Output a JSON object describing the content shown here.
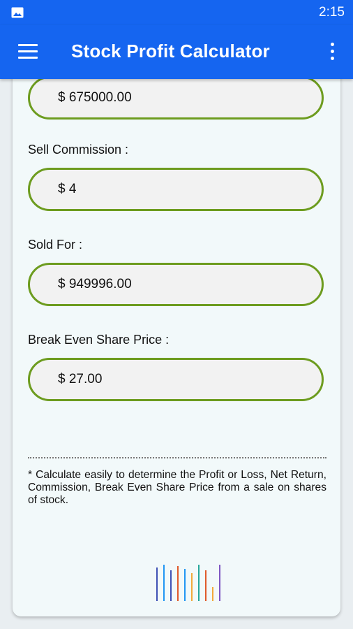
{
  "status_bar": {
    "time": "2:15",
    "left_icon": "image-notification-icon"
  },
  "app_bar": {
    "title": "Stock Profit Calculator",
    "menu_icon": "hamburger-menu-icon",
    "more_icon": "more-vert-icon"
  },
  "fields": {
    "total_cost": {
      "value": "$ 675000.00"
    },
    "sell_commission": {
      "label": "Sell Commission :",
      "value": "$ 4"
    },
    "sold_for": {
      "label": "Sold For :",
      "value": "$ 949996.00"
    },
    "break_even": {
      "label": "Break Even Share Price :",
      "value": "$ 27.00"
    }
  },
  "footer": {
    "note": "* Calculate easily to determine the Profit or Loss, Net Return, Commission, Break Even Share Price from a sale on shares of stock.",
    "logo": "bar-lines-logo"
  },
  "colors": {
    "primary": "#1565f0",
    "field_border": "#6d9c1f",
    "card_bg": "#f2f9fa"
  }
}
